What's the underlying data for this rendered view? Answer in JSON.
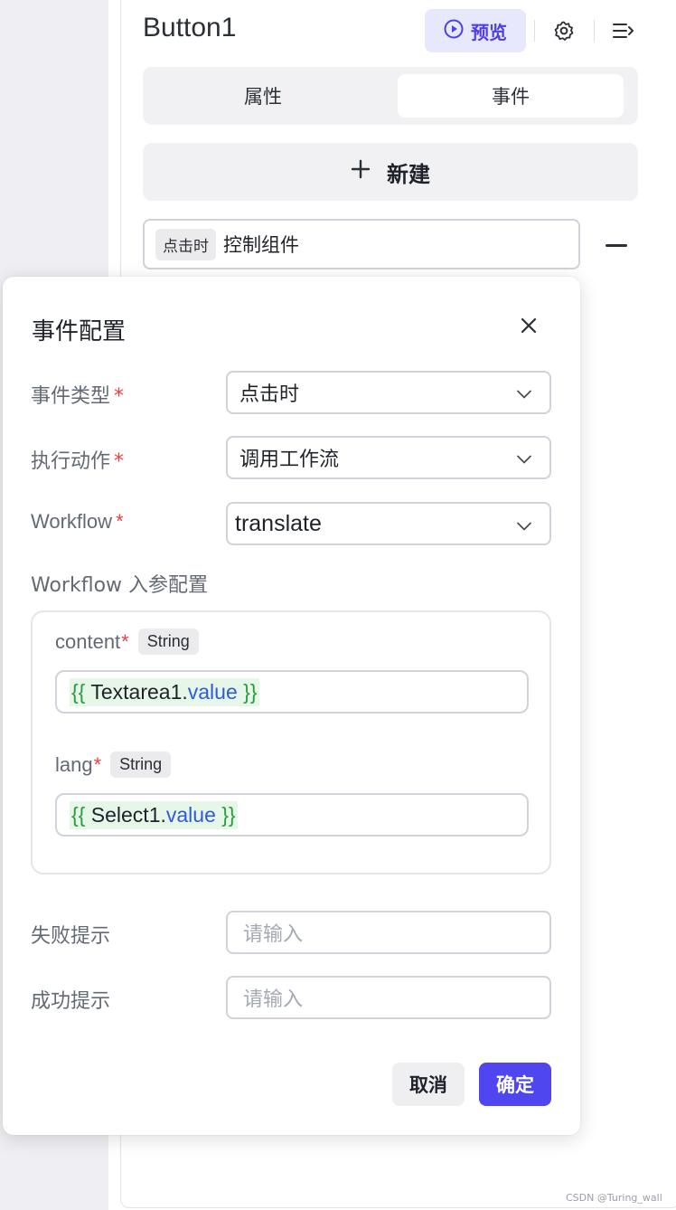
{
  "header": {
    "title": "Button1",
    "preview_label": "预览"
  },
  "tabs": [
    {
      "label": "属性",
      "active": false
    },
    {
      "label": "事件",
      "active": true
    }
  ],
  "new_button": {
    "label": "新建"
  },
  "event_item": {
    "trigger_tag": "点击时",
    "action_text": "控制组件"
  },
  "dialog": {
    "title": "事件配置",
    "event_type": {
      "label": "事件类型",
      "required_mark": "*",
      "value": "点击时"
    },
    "action": {
      "label": "执行动作",
      "required_mark": "*",
      "value": "调用工作流"
    },
    "workflow": {
      "label": "Workflow",
      "required_mark": "*",
      "value": "translate"
    },
    "params_label": "Workflow 入参配置",
    "params": [
      {
        "name": "content",
        "required_mark": "*",
        "type": "String",
        "open": "{{",
        "var": "Textarea1",
        "dot": ".",
        "prop": "value",
        "close": "}}"
      },
      {
        "name": "lang",
        "required_mark": "*",
        "type": "String",
        "open": "{{",
        "var": "Select1",
        "dot": ".",
        "prop": "value",
        "close": "}}"
      }
    ],
    "fail_tip": {
      "label": "失败提示",
      "placeholder": "请输入"
    },
    "success_tip": {
      "label": "成功提示",
      "placeholder": "请输入"
    },
    "cancel_label": "取消",
    "ok_label": "确定"
  },
  "watermark": "CSDN @Turing_wall",
  "colors": {
    "accent": "#4f46f0",
    "preview_bg": "#e8e8fd",
    "required": "#f03e3e",
    "code_brace": "#2b9c3e",
    "code_prop": "#2f5bd9"
  },
  "icons": {
    "preview": "play-circle-icon",
    "settings": "gear-icon",
    "panel": "collapse-panel-icon",
    "add": "plus-icon",
    "remove": "minus-icon",
    "close": "close-icon",
    "dropdown": "chevron-down-icon"
  }
}
